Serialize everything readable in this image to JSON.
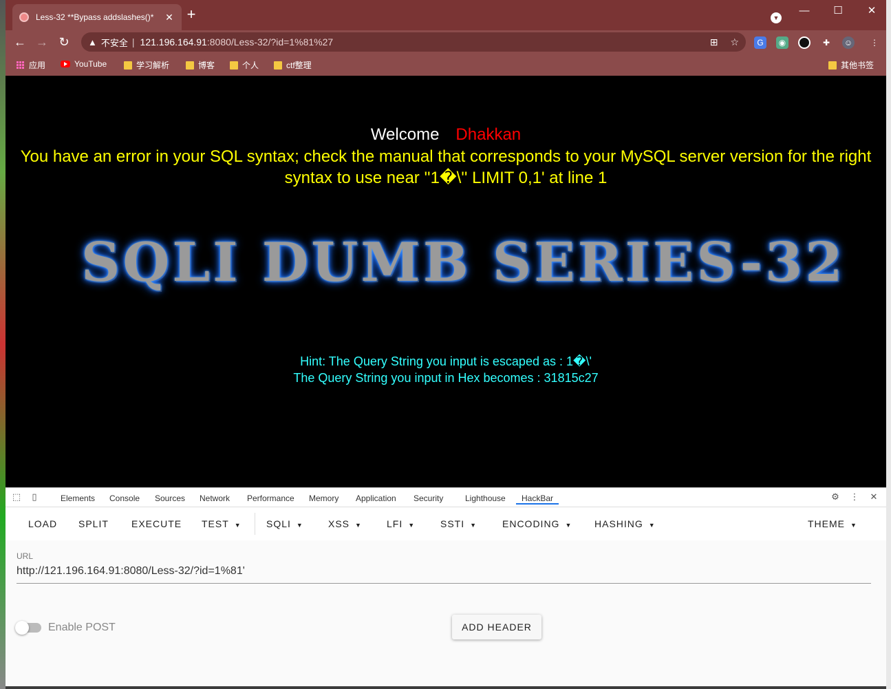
{
  "tab": {
    "title": "Less-32 **Bypass addslashes()*"
  },
  "address": {
    "security": "不安全",
    "host": "121.196.164.91",
    "path": ":8080/Less-32/?id=1%81%27"
  },
  "bookmarks": {
    "apps": "应用",
    "items": [
      "YouTube",
      "学习解析",
      "博客",
      "个人",
      "ctf整理"
    ],
    "other": "其他书签"
  },
  "page": {
    "welcome": "Welcome",
    "user": "Dhakkan",
    "error": "You have an error in your SQL syntax; check the manual that corresponds to your MySQL server version for the right syntax to use near ''1�\\'' LIMIT 0,1' at line 1",
    "banner": "SQLI DUMB SERIES-32",
    "hint1": "Hint: The Query String you input is escaped as : 1�\\'",
    "hint2": "The Query String you input in Hex becomes : 31815c27"
  },
  "devtools": {
    "tabs": [
      "Elements",
      "Console",
      "Sources",
      "Network",
      "Performance",
      "Memory",
      "Application",
      "Security",
      "Lighthouse",
      "HackBar"
    ],
    "active": "HackBar"
  },
  "hackbar": {
    "menu": [
      "LOAD",
      "SPLIT",
      "EXECUTE",
      "TEST",
      "SQLI",
      "XSS",
      "LFI",
      "SSTI",
      "ENCODING",
      "HASHING",
      "THEME"
    ],
    "url_label": "URL",
    "url": "http://121.196.164.91:8080/Less-32/?id=1%81'",
    "post_label": "Enable POST",
    "add_header": "ADD HEADER"
  },
  "colors": {
    "frame": "#7a3434",
    "toolbar": "#8b4b4b",
    "error_text": "#ffff00",
    "hint_text": "#33ffff",
    "user_text": "#ff0000",
    "tab_accent": "#1a73e8"
  }
}
